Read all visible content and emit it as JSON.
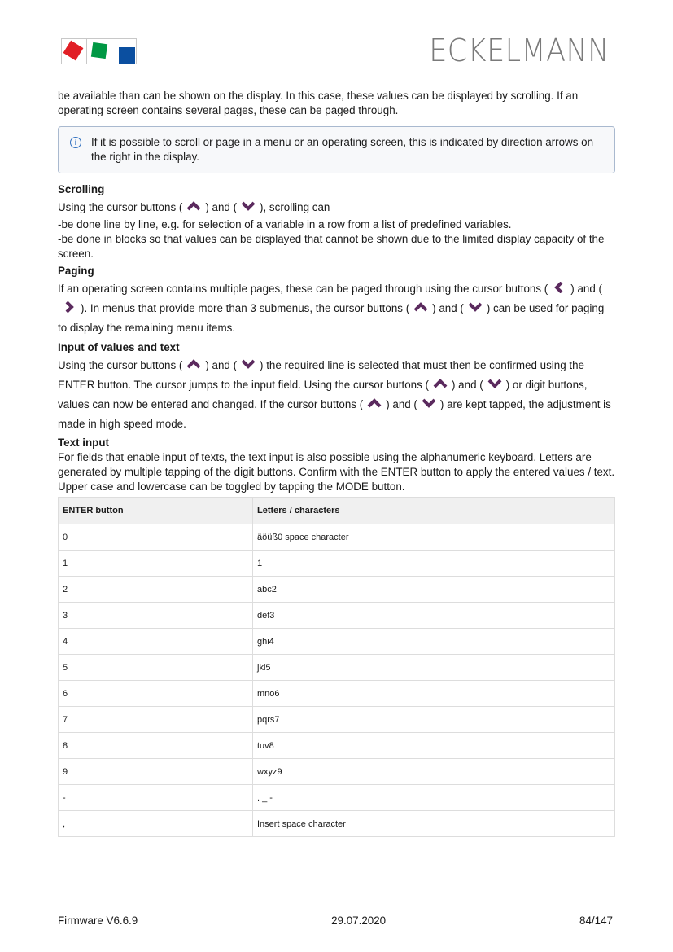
{
  "header": {
    "logo_name": "eckelmann-squares-logo",
    "brand": "ECKELMANN",
    "logo_colors": {
      "red": "#e11f26",
      "green": "#009844",
      "blue": "#0b4fa0"
    }
  },
  "intro": "be available than can be shown on the display. In this case, these values can be displayed by scrolling. If an operating screen contains several pages, these can be paged through.",
  "info_note": "If it is possible to scroll or page in a menu or an operating screen, this is indicated by direction arrows on the right in the display.",
  "arrow_color": "#5b2a5e",
  "scrolling": {
    "heading": "Scrolling",
    "l1a": "Using the cursor buttons (",
    "l1b": ") and (",
    "l1c": "), scrolling can",
    "l2": "-be done line by line, e.g. for selection of a variable in a row from a list of predefined variables.",
    "l3": "-be done in blocks so that values can be displayed that cannot be shown due to the limited display capacity of the screen."
  },
  "paging": {
    "heading": "Paging",
    "t1": "If an operating screen contains multiple pages, these can be paged through using the cursor buttons (",
    "t2": ")",
    "t3": "and (",
    "t4": "). In menus that provide more than 3 submenus, the cursor buttons (",
    "t5": ") and (",
    "t6": ") can be used for paging to display the remaining menu items."
  },
  "input": {
    "heading": "Input of values and text",
    "t1": "Using the cursor buttons (",
    "t2": ") and (",
    "t3": ") the required line is selected that must then be confirmed using the ENTER button. The cursor jumps to the input field. Using the cursor buttons (",
    "t4": ") and (",
    "t5": ") or digit buttons, values can now be entered and changed. If the cursor buttons (",
    "t6": ") and (",
    "t7": ") are kept tapped, the adjustment is made in high speed mode."
  },
  "text_input": {
    "heading": "Text input",
    "body": "For fields that enable input of texts, the text input is also possible using the alphanumeric keyboard. Letters are generated by multiple tapping of the digit buttons. Confirm with the ENTER button to apply the entered values / text. Upper case and lowercase can be toggled by tapping the MODE button."
  },
  "table": {
    "headers": [
      "ENTER button",
      "Letters / characters"
    ],
    "rows": [
      [
        "0",
        "äöüß0 space character"
      ],
      [
        "1",
        "1"
      ],
      [
        "2",
        "abc2"
      ],
      [
        "3",
        "def3"
      ],
      [
        "4",
        "ghi4"
      ],
      [
        "5",
        "jkl5"
      ],
      [
        "6",
        "mno6"
      ],
      [
        "7",
        "pqrs7"
      ],
      [
        "8",
        "tuv8"
      ],
      [
        "9",
        "wxyz9"
      ],
      [
        "-",
        ". _ -"
      ],
      [
        ",",
        "Insert space character"
      ]
    ]
  },
  "footer": {
    "left": "Firmware V6.6.9",
    "center": "29.07.2020",
    "right": "84/147"
  }
}
